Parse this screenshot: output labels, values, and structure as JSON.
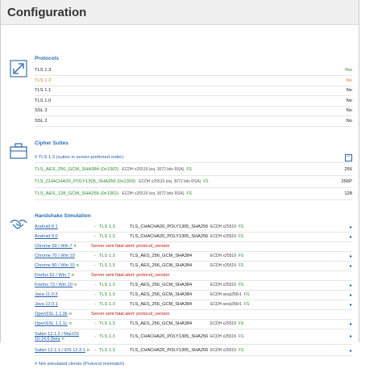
{
  "header": {
    "title": "Configuration"
  },
  "protocols": {
    "title": "Protocols",
    "rows": [
      {
        "name": "TLS 1.3",
        "value": "Yes",
        "name_color": "#222222",
        "value_color": "#2a8a2a"
      },
      {
        "name": "TLS 1.2",
        "value": "No",
        "name_color": "#e07a1f",
        "value_color": "#e07a1f"
      },
      {
        "name": "TLS 1.1",
        "value": "No",
        "name_color": "#222222",
        "value_color": "#222222"
      },
      {
        "name": "TLS 1.0",
        "value": "No",
        "name_color": "#222222",
        "value_color": "#222222"
      },
      {
        "name": "SSL 3",
        "value": "No",
        "name_color": "#222222",
        "value_color": "#222222"
      },
      {
        "name": "SSL 2",
        "value": "No",
        "name_color": "#222222",
        "value_color": "#222222"
      }
    ]
  },
  "ciphers": {
    "title": "Cipher Suites",
    "subhead": "# TLS 1.3 (suites in server-preferred order)",
    "collapse_label": "−",
    "rows": [
      {
        "name": "TLS_AES_256_GCM_SHA384 (0x1302)",
        "kx": "ECDH x25519 (eq. 3072 bits RSA)",
        "fs": "FS",
        "bits": "256"
      },
      {
        "name": "TLS_CHACHA20_POLY1305_SHA256 (0x1303)",
        "kx": "ECDH x25519 (eq. 3072 bits RSA)",
        "fs": "FS",
        "bits": "256P"
      },
      {
        "name": "TLS_AES_128_GCM_SHA256 (0x1301)",
        "kx": "ECDH x25519 (eq. 3072 bits RSA)",
        "fs": "FS",
        "bits": "128"
      }
    ]
  },
  "handshake": {
    "title": "Handshake Simulation",
    "rows": [
      {
        "client": "Android 8.1",
        "r": "",
        "dash": "-",
        "proto": "TLS 1.3",
        "suite": "TLS_CHACHA20_POLY1305_SHA256",
        "kx": "ECDH x25519",
        "fs": "FS",
        "alert": ""
      },
      {
        "client": "Android 9.0",
        "r": "",
        "dash": "-",
        "proto": "TLS 1.3",
        "suite": "TLS_CHACHA20_POLY1305_SHA256",
        "kx": "ECDH x25519",
        "fs": "FS",
        "alert": ""
      },
      {
        "client": "Chrome 69 / Win 7",
        "r": "R",
        "dash": "",
        "proto": "",
        "suite": "",
        "kx": "",
        "fs": "",
        "alert": "Server sent fatal alert: protocol_version"
      },
      {
        "client": "Chrome 70 / Win 10",
        "r": "",
        "dash": "-",
        "proto": "TLS 1.3",
        "suite": "TLS_AES_256_GCM_SHA384",
        "kx": "ECDH x25519",
        "fs": "FS",
        "alert": ""
      },
      {
        "client": "Chrome 80 / Win 10",
        "r": "R",
        "dash": "-",
        "proto": "TLS 1.3",
        "suite": "TLS_AES_256_GCM_SHA384",
        "kx": "ECDH x25519",
        "fs": "FS",
        "alert": ""
      },
      {
        "client": "Firefox 62 / Win 7",
        "r": "R",
        "dash": "",
        "proto": "",
        "suite": "",
        "kx": "",
        "fs": "",
        "alert": "Server sent fatal alert: protocol_version"
      },
      {
        "client": "Firefox 73 / Win 10",
        "r": "R",
        "dash": "-",
        "proto": "TLS 1.3",
        "suite": "TLS_AES_256_GCM_SHA384",
        "kx": "ECDH x25519",
        "fs": "FS",
        "alert": ""
      },
      {
        "client": "Java 11.0.3",
        "r": "",
        "dash": "-",
        "proto": "TLS 1.3",
        "suite": "TLS_AES_256_GCM_SHA384",
        "kx": "ECDH secp256r1",
        "fs": "FS",
        "alert": ""
      },
      {
        "client": "Java 12.0.1",
        "r": "",
        "dash": "-",
        "proto": "TLS 1.3",
        "suite": "TLS_AES_256_GCM_SHA384",
        "kx": "ECDH secp256r1",
        "fs": "FS",
        "alert": ""
      },
      {
        "client": "OpenSSL 1.1.0k",
        "r": "R",
        "dash": "",
        "proto": "",
        "suite": "",
        "kx": "",
        "fs": "",
        "alert": "Server sent fatal alert: protocol_version"
      },
      {
        "client": "OpenSSL 1.1.1c",
        "r": "R",
        "dash": "-",
        "proto": "TLS 1.3",
        "suite": "TLS_AES_256_GCM_SHA384",
        "kx": "ECDH x25519",
        "fs": "FS",
        "alert": ""
      },
      {
        "client": "Safari 12.1.2 / MacOS 10.14.6 Beta",
        "r": "R",
        "dash": "-",
        "proto": "TLS 1.3",
        "suite": "TLS_CHACHA20_POLY1305_SHA256",
        "kx": "ECDH x25519",
        "fs": "FS",
        "alert": ""
      },
      {
        "client": "Safari 12.1.1 / iOS 12.3.1",
        "r": "R",
        "dash": "-",
        "proto": "TLS 1.3",
        "suite": "TLS_CHACHA20_POLY1305_SHA256",
        "kx": "ECDH x25519",
        "fs": "FS",
        "alert": ""
      }
    ],
    "footer": "# Not simulated clients (Protocol mismatch)"
  }
}
